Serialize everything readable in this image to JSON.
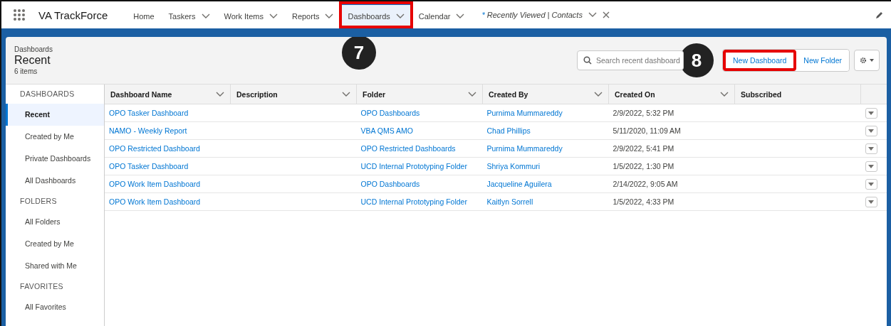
{
  "app": {
    "name": "VA TrackForce"
  },
  "nav": [
    {
      "label": "Home",
      "dropdown": false,
      "selected": false,
      "highlighted": false
    },
    {
      "label": "Taskers",
      "dropdown": true,
      "selected": false,
      "highlighted": false
    },
    {
      "label": "Work Items",
      "dropdown": true,
      "selected": false,
      "highlighted": false
    },
    {
      "label": "Reports",
      "dropdown": true,
      "selected": false,
      "highlighted": false
    },
    {
      "label": "Dashboards",
      "dropdown": true,
      "selected": true,
      "highlighted": true
    },
    {
      "label": "Calendar",
      "dropdown": true,
      "selected": false,
      "highlighted": false
    }
  ],
  "open_tab": {
    "marker": "*",
    "label": "Recently Viewed | Contacts"
  },
  "header": {
    "breadcrumb": "Dashboards",
    "title": "Recent",
    "count": "6 items"
  },
  "callouts": [
    "7",
    "8"
  ],
  "search": {
    "placeholder": "Search recent dashboard"
  },
  "buttons": [
    {
      "label": "New Dashboard",
      "highlighted": true
    },
    {
      "label": "New Folder",
      "highlighted": false
    }
  ],
  "sidebar": [
    {
      "heading": "DASHBOARDS",
      "items": [
        {
          "label": "Recent",
          "selected": true
        },
        {
          "label": "Created by Me",
          "selected": false
        },
        {
          "label": "Private Dashboards",
          "selected": false
        },
        {
          "label": "All Dashboards",
          "selected": false
        }
      ]
    },
    {
      "heading": "FOLDERS",
      "items": [
        {
          "label": "All Folders",
          "selected": false
        },
        {
          "label": "Created by Me",
          "selected": false
        },
        {
          "label": "Shared with Me",
          "selected": false
        }
      ]
    },
    {
      "heading": "FAVORITES",
      "items": [
        {
          "label": "All Favorites",
          "selected": false
        }
      ]
    }
  ],
  "table": {
    "columns": [
      {
        "label": "Dashboard Name",
        "sortable": true
      },
      {
        "label": "Description",
        "sortable": true
      },
      {
        "label": "Folder",
        "sortable": true
      },
      {
        "label": "Created By",
        "sortable": true
      },
      {
        "label": "Created On",
        "sortable": true
      },
      {
        "label": "Subscribed",
        "sortable": false
      }
    ],
    "rows": [
      {
        "name": "OPO Tasker Dashboard",
        "description": "",
        "folder": "OPO Dashboards",
        "created_by": "Purnima Mummareddy",
        "created_on": "2/9/2022, 5:32 PM"
      },
      {
        "name": "NAMO - Weekly Report",
        "description": "",
        "folder": "VBA QMS AMO",
        "created_by": "Chad Phillips",
        "created_on": "5/11/2020, 11:09 AM"
      },
      {
        "name": "OPO Restricted Dashboard",
        "description": "",
        "folder": "OPO Restricted Dashboards",
        "created_by": "Purnima Mummareddy",
        "created_on": "2/9/2022, 5:41 PM"
      },
      {
        "name": "OPO Tasker Dashboard",
        "description": "",
        "folder": "UCD Internal Prototyping Folder",
        "created_by": "Shriya Kommuri",
        "created_on": "1/5/2022, 1:30 PM"
      },
      {
        "name": "OPO Work Item Dashboard",
        "description": "",
        "folder": "OPO Dashboards",
        "created_by": "Jacqueline Aguilera",
        "created_on": "2/14/2022, 9:05 AM"
      },
      {
        "name": "OPO Work Item Dashboard",
        "description": "",
        "folder": "UCD Internal Prototyping Folder",
        "created_by": "Kaitlyn Sorrell",
        "created_on": "1/5/2022, 4:33 PM"
      }
    ]
  }
}
